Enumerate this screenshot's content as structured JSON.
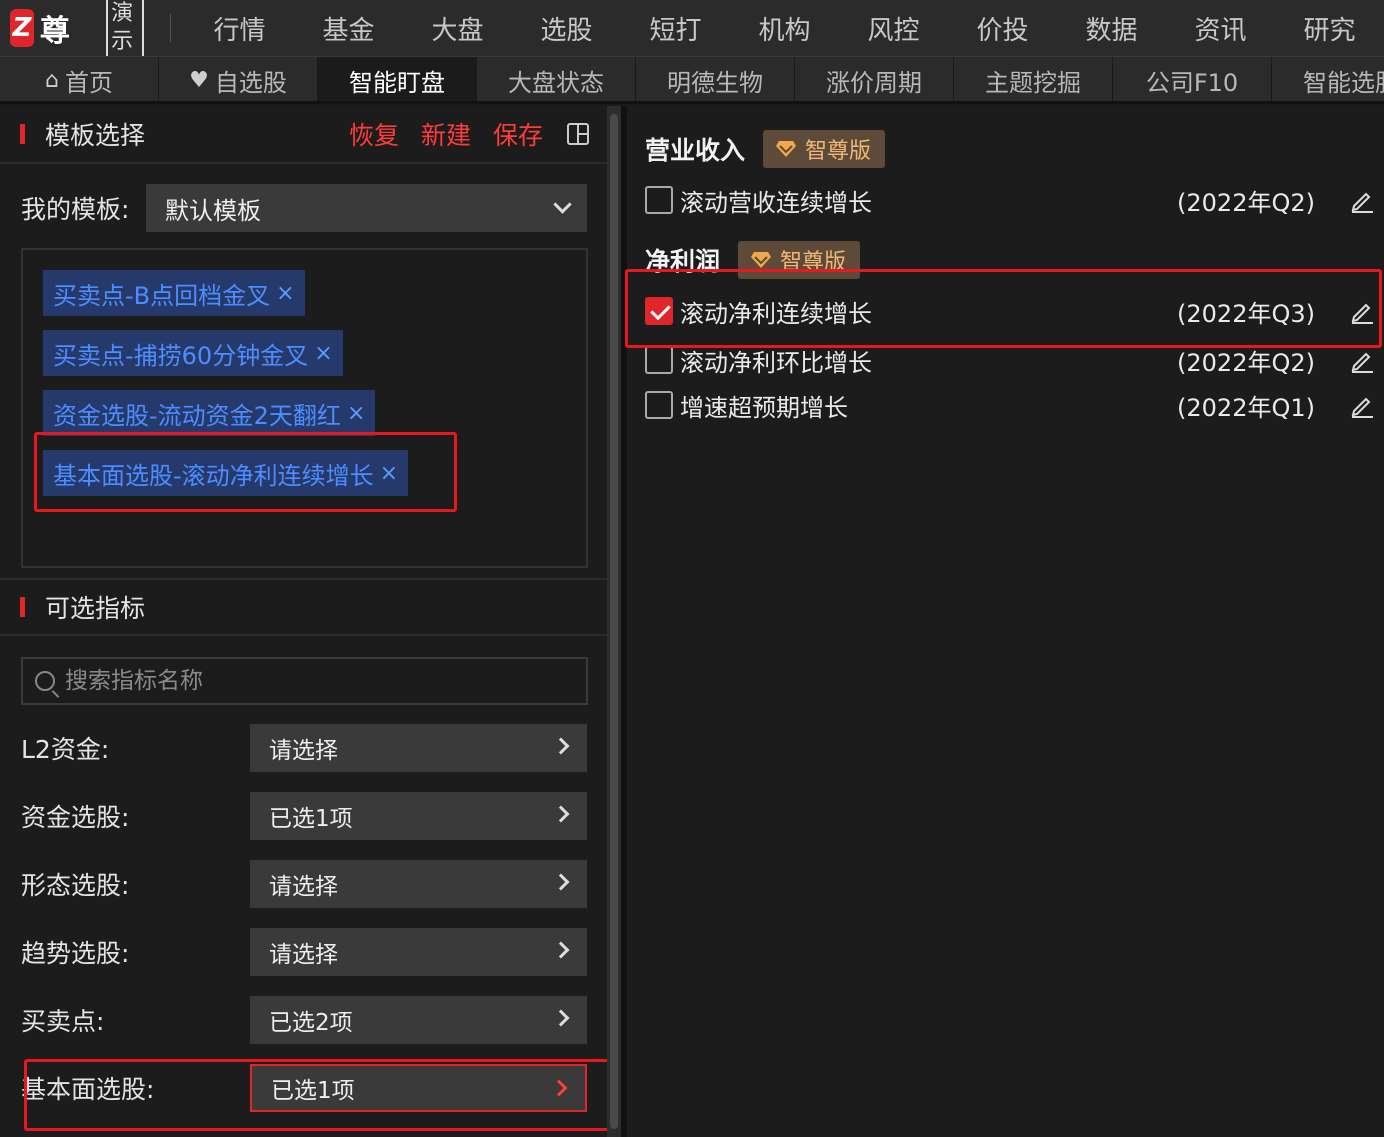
{
  "app": {
    "logo_glyph": "Z",
    "brand": "智尊版",
    "demo_badge": "演示"
  },
  "topnav": [
    "行情",
    "基金",
    "大盘",
    "选股",
    "短打",
    "机构",
    "风控",
    "价投",
    "数据",
    "资讯",
    "研究"
  ],
  "tabs": [
    {
      "label": "首页",
      "icon": "home-icon"
    },
    {
      "label": "自选股",
      "icon": "heart-icon"
    },
    {
      "label": "智能盯盘",
      "active": true
    },
    {
      "label": "大盘状态"
    },
    {
      "label": "明德生物"
    },
    {
      "label": "涨价周期"
    },
    {
      "label": "主题挖掘"
    },
    {
      "label": "公司F10"
    },
    {
      "label": "智能选股"
    }
  ],
  "template": {
    "title": "模板选择",
    "actions": {
      "restore": "恢复",
      "create": "新建",
      "save": "保存"
    },
    "my_label": "我的模板:",
    "selected": "默认模板",
    "tags": [
      "买卖点-B点回档金叉",
      "买卖点-捕捞60分钟金叉",
      "资金选股-流动资金2天翻红",
      "基本面选股-滚动净利连续增长"
    ],
    "tag_close": "×"
  },
  "indicators": {
    "title": "可选指标",
    "search_placeholder": "搜索指标名称",
    "rows": [
      {
        "label": "L2资金:",
        "value": "请选择"
      },
      {
        "label": "资金选股:",
        "value": "已选1项"
      },
      {
        "label": "形态选股:",
        "value": "请选择"
      },
      {
        "label": "趋势选股:",
        "value": "请选择"
      },
      {
        "label": "买卖点:",
        "value": "已选2项"
      },
      {
        "label": "基本面选股:",
        "value": "已选1项"
      }
    ]
  },
  "right": {
    "badge": "智尊版",
    "groups": [
      {
        "title": "营业收入",
        "items": [
          {
            "label": "滚动营收连续增长",
            "period": "(2022年Q2)",
            "checked": false
          }
        ]
      },
      {
        "title": "净利润",
        "items": [
          {
            "label": "滚动净利连续增长",
            "period": "(2022年Q3)",
            "checked": true
          },
          {
            "label": "滚动净利环比增长",
            "period": "(2022年Q2)",
            "checked": false
          },
          {
            "label": "增速超预期增长",
            "period": "(2022年Q1)",
            "checked": false
          }
        ]
      }
    ]
  },
  "colors": {
    "accent_red": "#e0262b",
    "tag_bg": "#253a6b",
    "tag_text": "#4d8dff",
    "badge_bg": "#5e4a38",
    "badge_text": "#f0b878"
  }
}
